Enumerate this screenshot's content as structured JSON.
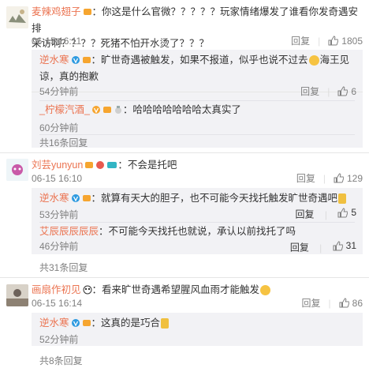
{
  "comments": [
    {
      "user": "麦辣鸡翅子",
      "text_line1": "：你这是什么官微？？？？？玩家情绪爆发了谁看你发奇遇安排",
      "text_line2": "采访啊？？？？死猪不怕开水烫了？？？",
      "time": "06-15 16:11",
      "reply_label": "回复",
      "likes": "1805",
      "replies": [
        {
          "user": "逆水寒",
          "text_line1": "：旷世奇遇被触发，如果不报道，似乎也说不过去",
          "text_tail": "海王见",
          "text_line2": "谅，真的抱歉",
          "time": "54分钟前",
          "likes": "6"
        },
        {
          "user": "_柠檬汽酒_",
          "text_line1": "：哈哈哈哈哈哈哈太真实了",
          "time": "60分钟前",
          "likes": ""
        }
      ],
      "more": "共16条回复"
    },
    {
      "user": "刘芸yunyun",
      "text_line1": "：不会是托吧",
      "time": "06-15 16:10",
      "reply_label": "回复",
      "likes": "129",
      "replies": [
        {
          "user": "逆水寒",
          "text_line1": "：就算有天大的胆子，也不可能今天找托触发旷世奇遇吧",
          "time": "53分钟前",
          "likes": "5"
        },
        {
          "user": "艾辰辰辰辰辰",
          "text_line1": "：不可能今天找托也就说，承认以前找托了吗",
          "time": "46分钟前",
          "likes": "31"
        }
      ],
      "more": "共31条回复"
    },
    {
      "user": "画扇作初见",
      "text_line1": "：看来旷世奇遇希望腥风血雨才能触发",
      "time": "06-15 16:14",
      "reply_label": "回复",
      "likes": "86",
      "replies": [
        {
          "user": "逆水寒",
          "text_line1": "：这真的是巧合",
          "time": "52分钟前",
          "likes": ""
        }
      ],
      "more": "共8条回复"
    }
  ],
  "reply_label": "回复",
  "colors": {
    "username": "#eb7350",
    "muted": "#808080",
    "reply_bg": "#f2f2f5"
  }
}
